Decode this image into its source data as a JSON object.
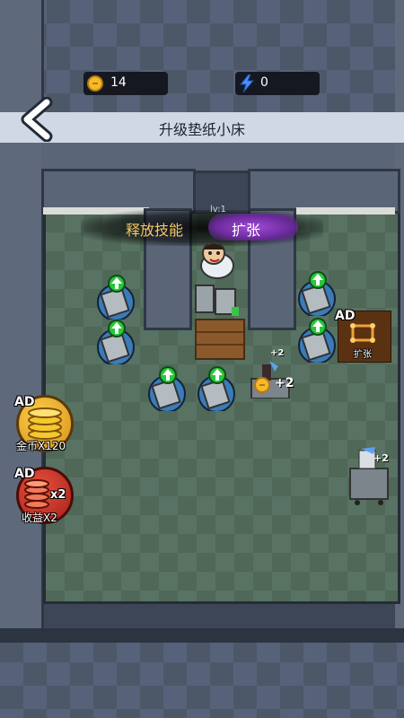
{
  "header": {
    "coins": "14",
    "energy": "0",
    "coin_icon": "coin-icon",
    "energy_icon": "lightning-icon",
    "back_icon": "chevron-left-icon"
  },
  "title": "升级垫纸小床",
  "skill": {
    "level": "lv:1",
    "label": "释放技能",
    "action": "扩张"
  },
  "side_buttons": {
    "coins_ad": {
      "tag": "AD",
      "label": "金币X120"
    },
    "income_ad": {
      "tag": "AD",
      "label": "收益X2",
      "badge": "x2"
    },
    "expand_ad": {
      "tag": "AD",
      "label": "扩张"
    }
  },
  "carts": {
    "center_plus": "+2",
    "center_small_plus": "+2",
    "right_plus": "+2"
  },
  "colors": {
    "accent_gold": "#f6b92b",
    "accent_purple": "#a24ad8",
    "upgrade_green": "#28c83a"
  }
}
